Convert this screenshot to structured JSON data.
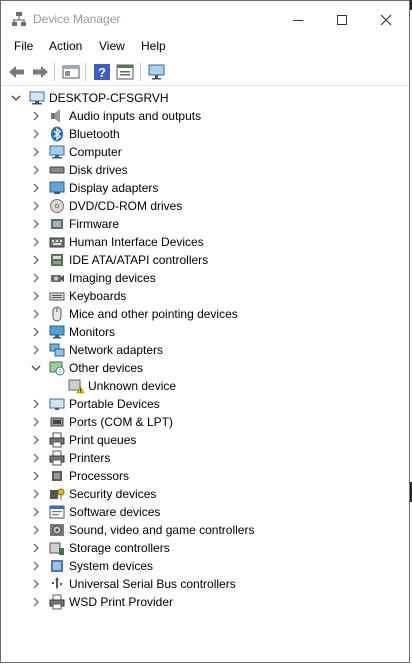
{
  "window": {
    "title": "Device Manager"
  },
  "menu": [
    "File",
    "Action",
    "View",
    "Help"
  ],
  "tree": {
    "root": "DESKTOP-CFSGRVH",
    "categories": [
      {
        "label": "Audio inputs and outputs",
        "icon": "speaker-icon"
      },
      {
        "label": "Bluetooth",
        "icon": "bluetooth-icon"
      },
      {
        "label": "Computer",
        "icon": "computer-icon"
      },
      {
        "label": "Disk drives",
        "icon": "disk-drive-icon"
      },
      {
        "label": "Display adapters",
        "icon": "display-adapter-icon"
      },
      {
        "label": "DVD/CD-ROM drives",
        "icon": "dvd-drive-icon"
      },
      {
        "label": "Firmware",
        "icon": "firmware-icon"
      },
      {
        "label": "Human Interface Devices",
        "icon": "hid-icon"
      },
      {
        "label": "IDE ATA/ATAPI controllers",
        "icon": "ide-controller-icon"
      },
      {
        "label": "Imaging devices",
        "icon": "camera-icon"
      },
      {
        "label": "Keyboards",
        "icon": "keyboard-icon"
      },
      {
        "label": "Mice and other pointing devices",
        "icon": "mouse-icon"
      },
      {
        "label": "Monitors",
        "icon": "monitor-icon"
      },
      {
        "label": "Network adapters",
        "icon": "network-adapter-icon"
      },
      {
        "label": "Other devices",
        "icon": "other-devices-icon",
        "expanded": true
      },
      {
        "label": "Unknown device",
        "icon": "unknown-device-warning-icon",
        "child": true
      },
      {
        "label": "Portable Devices",
        "icon": "portable-device-icon"
      },
      {
        "label": "Ports (COM & LPT)",
        "icon": "port-icon"
      },
      {
        "label": "Print queues",
        "icon": "printer-icon"
      },
      {
        "label": "Printers",
        "icon": "printer-icon"
      },
      {
        "label": "Processors",
        "icon": "processor-icon"
      },
      {
        "label": "Security devices",
        "icon": "security-device-icon"
      },
      {
        "label": "Software devices",
        "icon": "software-device-icon"
      },
      {
        "label": "Sound, video and game controllers",
        "icon": "sound-controller-icon"
      },
      {
        "label": "Storage controllers",
        "icon": "storage-controller-icon"
      },
      {
        "label": "System devices",
        "icon": "system-device-icon"
      },
      {
        "label": "Universal Serial Bus controllers",
        "icon": "usb-icon"
      },
      {
        "label": "WSD Print Provider",
        "icon": "printer-icon"
      }
    ]
  }
}
